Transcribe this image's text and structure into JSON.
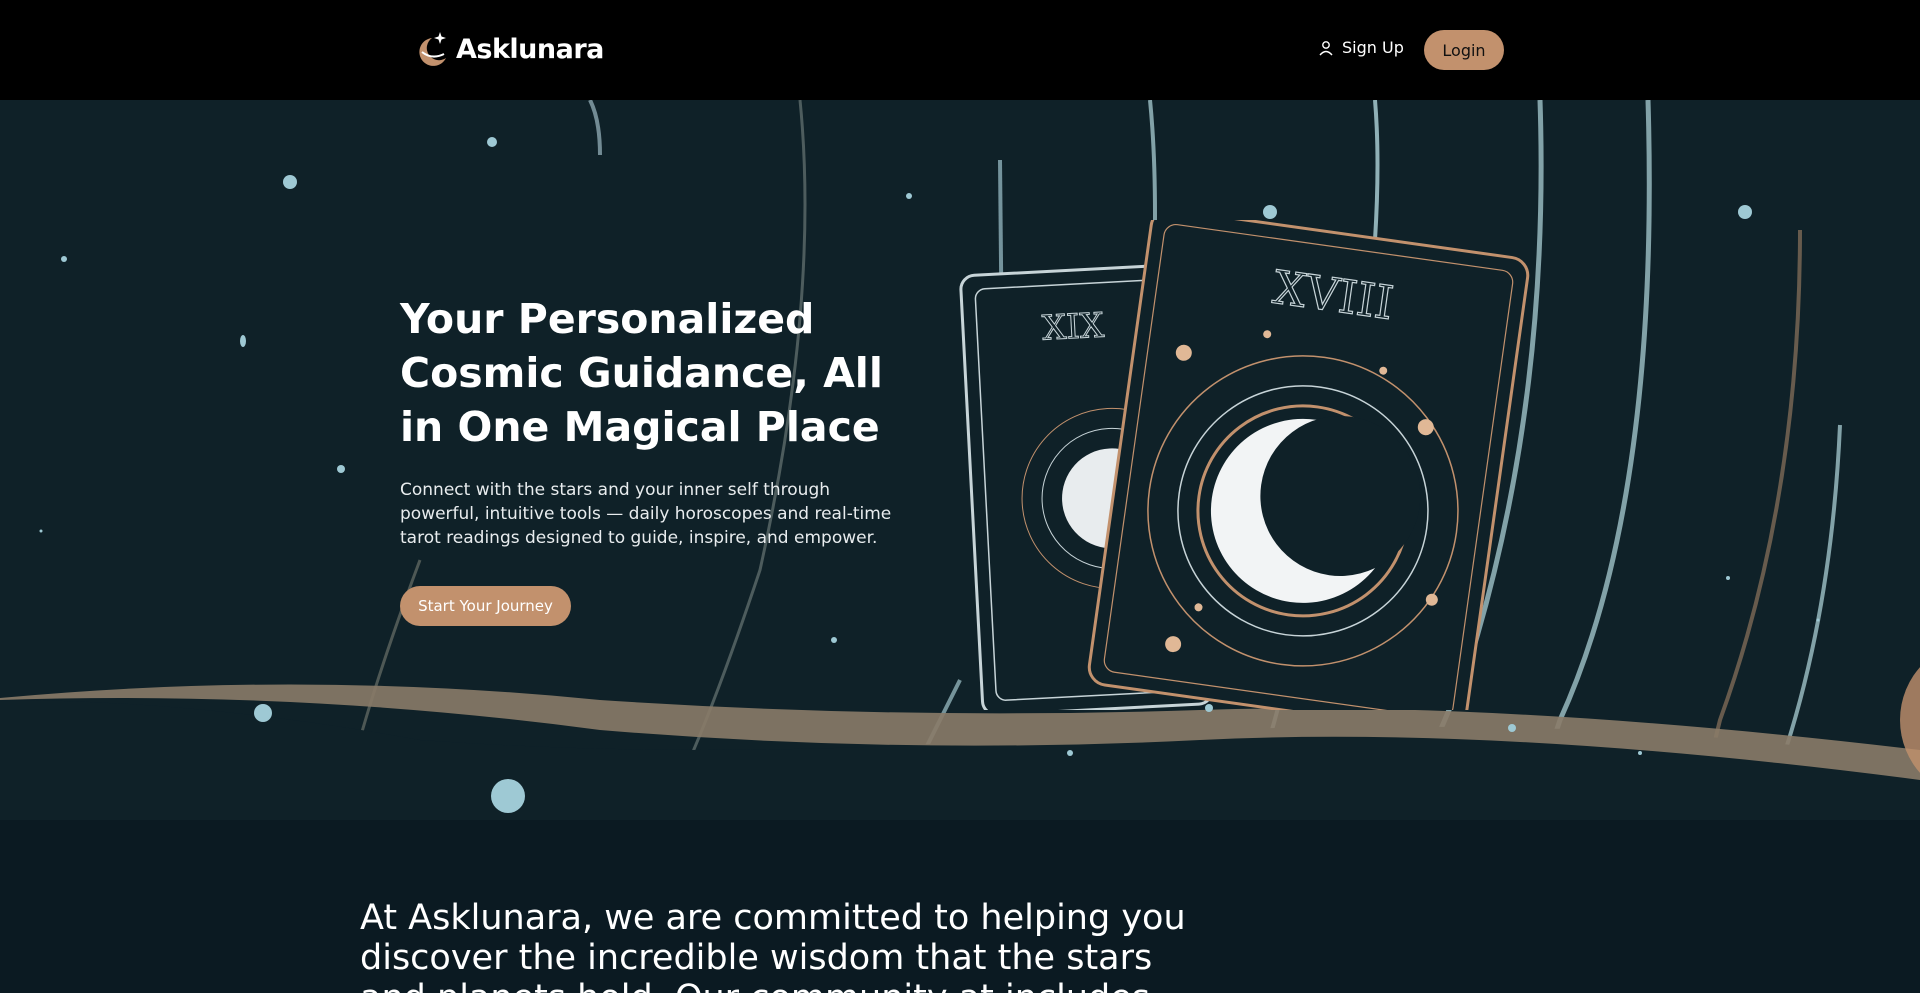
{
  "brand": {
    "name": "Asklunara"
  },
  "nav": {
    "signup_label": "Sign Up",
    "login_label": "Login"
  },
  "hero": {
    "title": "Your Personalized Cosmic Guidance, All in One Magical Place",
    "description": "Connect with the stars and your inner self through powerful, intuitive tools — daily horoscopes and real-time tarot readings designed to guide, inspire, and empower.",
    "cta_label": "Start Your Journey",
    "card_numerals": [
      "XIX",
      "XVIII"
    ]
  },
  "mission": {
    "text": "At Asklunara, we are committed to helping you discover the incredible wisdom that the stars and planets hold. Our community at includes"
  },
  "colors": {
    "accent": "#c2916d",
    "navbar_bg": "#000000",
    "hero_bg": "#0f2128",
    "star_blue": "#9ec9d4"
  },
  "icons": {
    "logo": "crescent-moon-star-icon",
    "signup": "user-icon"
  }
}
